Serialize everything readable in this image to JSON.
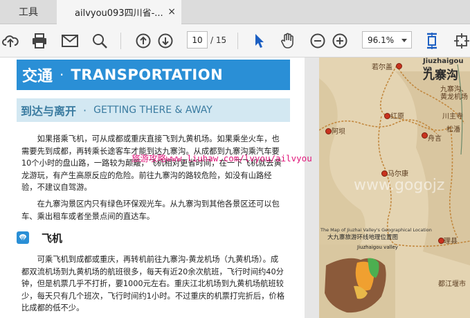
{
  "tabs": {
    "tools": "工具",
    "document": "ailvyou093四川省-...",
    "close": "×"
  },
  "toolbar": {
    "page_current": "10",
    "page_total": "/ 15",
    "zoom": "96.1%"
  },
  "doc": {
    "heading": {
      "cn": "交通",
      "dot": "·",
      "en": "TRANSPORTATION"
    },
    "subheading": {
      "cn": "到达与离开",
      "dot": "·",
      "en": "GETTING THERE & AWAY"
    },
    "para1": "如果搭乘飞机，可从成都或重庆直接飞到九黄机场。如果乘坐火车，也需要先到成都，再转乘长途客车才能到达九寨沟。从成都到九寨沟乘汽车要10个小时的盘山路，一路较为颠簸，飞机相对更省时间，在一下飞机就去黄龙游玩，有产生高原反应的危险。前往九寨沟的路较危险，如没有山路经验，不建议自驾游。",
    "para2": "在九寨沟景区内只有绿色环保观光车。从九寨沟到其他各景区还可以包车、乘出租车或者坐景点间的直达车。",
    "section_title": "飞机",
    "para3": "可乘飞机到成都或重庆，再转机前往九寨沟-黄龙机场（九黄机场）。成都双流机场到九黄机场的航班很多，每天有近20余次航班，飞行时间约40分钟，但是机票几乎不打折，要1000元左右。重庆江北机场到九黄机场航班较少，每天只有几个班次，飞行时间约1小时。不过重庆的机票打完折后，价格比成都的低不少。",
    "watermark": "旅游攻略www.liuhaw.com/lvyou/ailvyou"
  },
  "map": {
    "title_en": "Jiuzhaigou va",
    "title_cn": "九寨沟",
    "watermark": "www.gogojz",
    "labels": {
      "ruoergai": "若尔盖",
      "jiuzhaigou_airport": "九寨沟、",
      "huanglong_airport": "黄龙机场",
      "hongyuan": "红原",
      "chuanzhusi": "川主寺",
      "songpan": "松潘",
      "aba": "阿坝",
      "maerkang": "马尔康",
      "lixian": "理县",
      "dujiangyan": "都江堰市",
      "zhouyan": "舟言"
    },
    "inset": {
      "title_en": "The Map of Jiuzhai Valley's Geographical Location",
      "title_cn": "大九寨旅游环线地理位置图",
      "valley": "Jiuzhaigou valley"
    }
  },
  "colors": {
    "accent_blue": "#2a8fd6",
    "subheading_bg": "#d3e8f2",
    "watermark_pink": "#e0177a",
    "map_bg": "#e4d4b2"
  }
}
